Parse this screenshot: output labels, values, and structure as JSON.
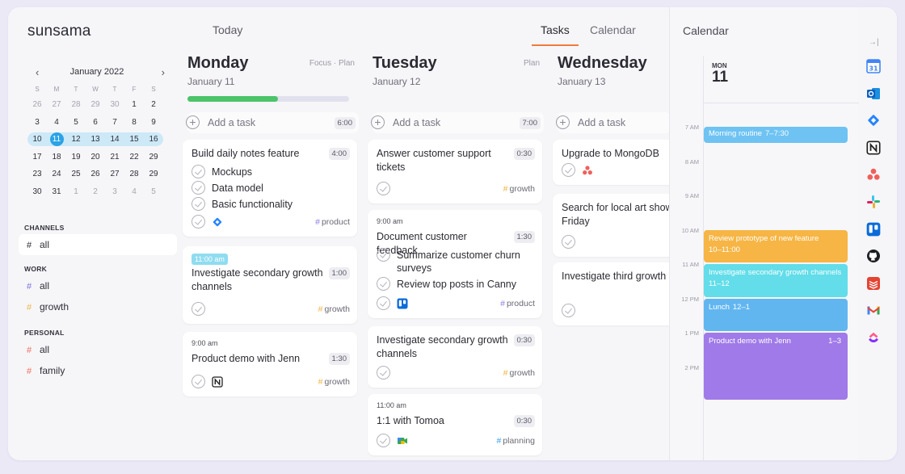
{
  "app": {
    "logo": "sunsama"
  },
  "header": {
    "today_label": "Today",
    "tabs": [
      {
        "label": "Tasks",
        "active": true
      },
      {
        "label": "Calendar",
        "active": false
      }
    ]
  },
  "mini_calendar": {
    "month_label": "January 2022",
    "weekdays": [
      "S",
      "M",
      "T",
      "W",
      "T",
      "F",
      "S"
    ],
    "weeks": [
      [
        "26",
        "27",
        "28",
        "29",
        "30",
        "1",
        "2"
      ],
      [
        "3",
        "4",
        "5",
        "6",
        "7",
        "8",
        "9"
      ],
      [
        "10",
        "11",
        "12",
        "13",
        "14",
        "15",
        "16"
      ],
      [
        "17",
        "18",
        "19",
        "20",
        "21",
        "22",
        "29"
      ],
      [
        "23",
        "24",
        "25",
        "26",
        "27",
        "28",
        "29"
      ],
      [
        "30",
        "31",
        "1",
        "2",
        "3",
        "4",
        "5"
      ]
    ],
    "today": "11"
  },
  "sidebar": {
    "sections": [
      {
        "title": "CHANNELS",
        "items": [
          {
            "label": "all",
            "hash": "#",
            "color": "#2b2b33",
            "active": true
          }
        ]
      },
      {
        "title": "WORK",
        "items": [
          {
            "label": "all",
            "hash": "#",
            "color": "#7b6fe0"
          },
          {
            "label": "growth",
            "hash": "#",
            "color": "#f0b445"
          }
        ]
      },
      {
        "title": "PERSONAL",
        "items": [
          {
            "label": "all",
            "hash": "#",
            "color": "#ef6a5a"
          },
          {
            "label": "family",
            "hash": "#",
            "color": "#ef6a5a"
          }
        ]
      }
    ]
  },
  "days": [
    {
      "name": "Monday",
      "date": "January 11",
      "links": "Focus · Plan",
      "progress": 0.56,
      "add_label": "Add a task",
      "add_duration": "6:00",
      "cards": [
        {
          "title": "Build daily notes feature",
          "duration": "4:00",
          "subtasks": [
            "Mockups",
            "Data model",
            "Basic functionality"
          ],
          "icon": "jira-icon",
          "tag": "product",
          "tag_color": "#8b7fe8"
        },
        {
          "time": "11:00 am",
          "time_badge": true,
          "title": "Investigate secondary growth channels",
          "duration": "1:00",
          "tag": "growth",
          "tag_color": "#f0b445"
        },
        {
          "time": "9:00 am",
          "title": "Product demo with Jenn",
          "duration": "1:30",
          "icon": "notion-icon",
          "tag": "growth",
          "tag_color": "#f0b445"
        }
      ]
    },
    {
      "name": "Tuesday",
      "date": "January 12",
      "links": "Plan",
      "add_label": "Add a task",
      "add_duration": "7:00",
      "cards": [
        {
          "title": "Answer customer support tickets",
          "duration": "0:30",
          "tag": "growth",
          "tag_color": "#f0b445"
        },
        {
          "time": "9:00 am",
          "title": "Document customer feedback",
          "duration": "1:30",
          "subtasks": [
            "Summarize customer churn surveys",
            "Review top posts in Canny"
          ],
          "icon": "trello-icon",
          "tag": "product",
          "tag_color": "#8b7fe8"
        },
        {
          "title": "Investigate secondary growth channels",
          "duration": "0:30",
          "tag": "growth",
          "tag_color": "#f0b445"
        },
        {
          "time": "11:00 am",
          "title": "1:1 with Tomoa",
          "duration": "0:30",
          "icon": "google-meet-icon",
          "tag": "planning",
          "tag_color": "#3aa0e8"
        }
      ]
    },
    {
      "name": "Wednesday",
      "date": "January 13",
      "add_label": "Add a task",
      "cards": [
        {
          "title": "Upgrade to MongoDB",
          "icon": "asana-icon"
        },
        {
          "title": "Search for local art shows on First Friday"
        },
        {
          "title": "Investigate third growth channels"
        }
      ]
    }
  ],
  "calendar_panel": {
    "title": "Calendar",
    "day_of_week": "MON",
    "day_number": "11",
    "hours": [
      "7 AM",
      "8 AM",
      "9 AM",
      "10 AM",
      "11 AM",
      "12 PM",
      "1 PM",
      "2 PM"
    ],
    "events": [
      {
        "title": "Morning routine",
        "time": "7–7:30",
        "color": "#6ec3f3",
        "start": 7.0,
        "end": 7.5
      },
      {
        "title": "Review prototype of new feature",
        "time": "10–11:00",
        "color": "#f6b544",
        "start": 10.0,
        "end": 11.0,
        "two_line": true
      },
      {
        "title": "Investigate secondary growth channels",
        "time": "11–12",
        "color": "#62dde9",
        "start": 11.0,
        "end": 12.0,
        "two_line": true
      },
      {
        "title": "Lunch",
        "time": "12–1",
        "color": "#62b6f0",
        "start": 12.0,
        "end": 13.0
      },
      {
        "title": "Product demo with Jenn",
        "time": "1–3",
        "color": "#a07ae8",
        "start": 13.0,
        "end": 15.0,
        "time_right": true
      }
    ]
  },
  "integrations": [
    "google-calendar-icon",
    "outlook-icon",
    "jira-icon",
    "notion-icon",
    "asana-icon",
    "slack-icon",
    "trello-icon",
    "github-icon",
    "todoist-icon",
    "gmail-icon",
    "clickup-icon"
  ],
  "colors": {
    "accent_tab": "#f07a3e",
    "today_circle": "#2ba3e6",
    "progress": "#4cc46a"
  }
}
